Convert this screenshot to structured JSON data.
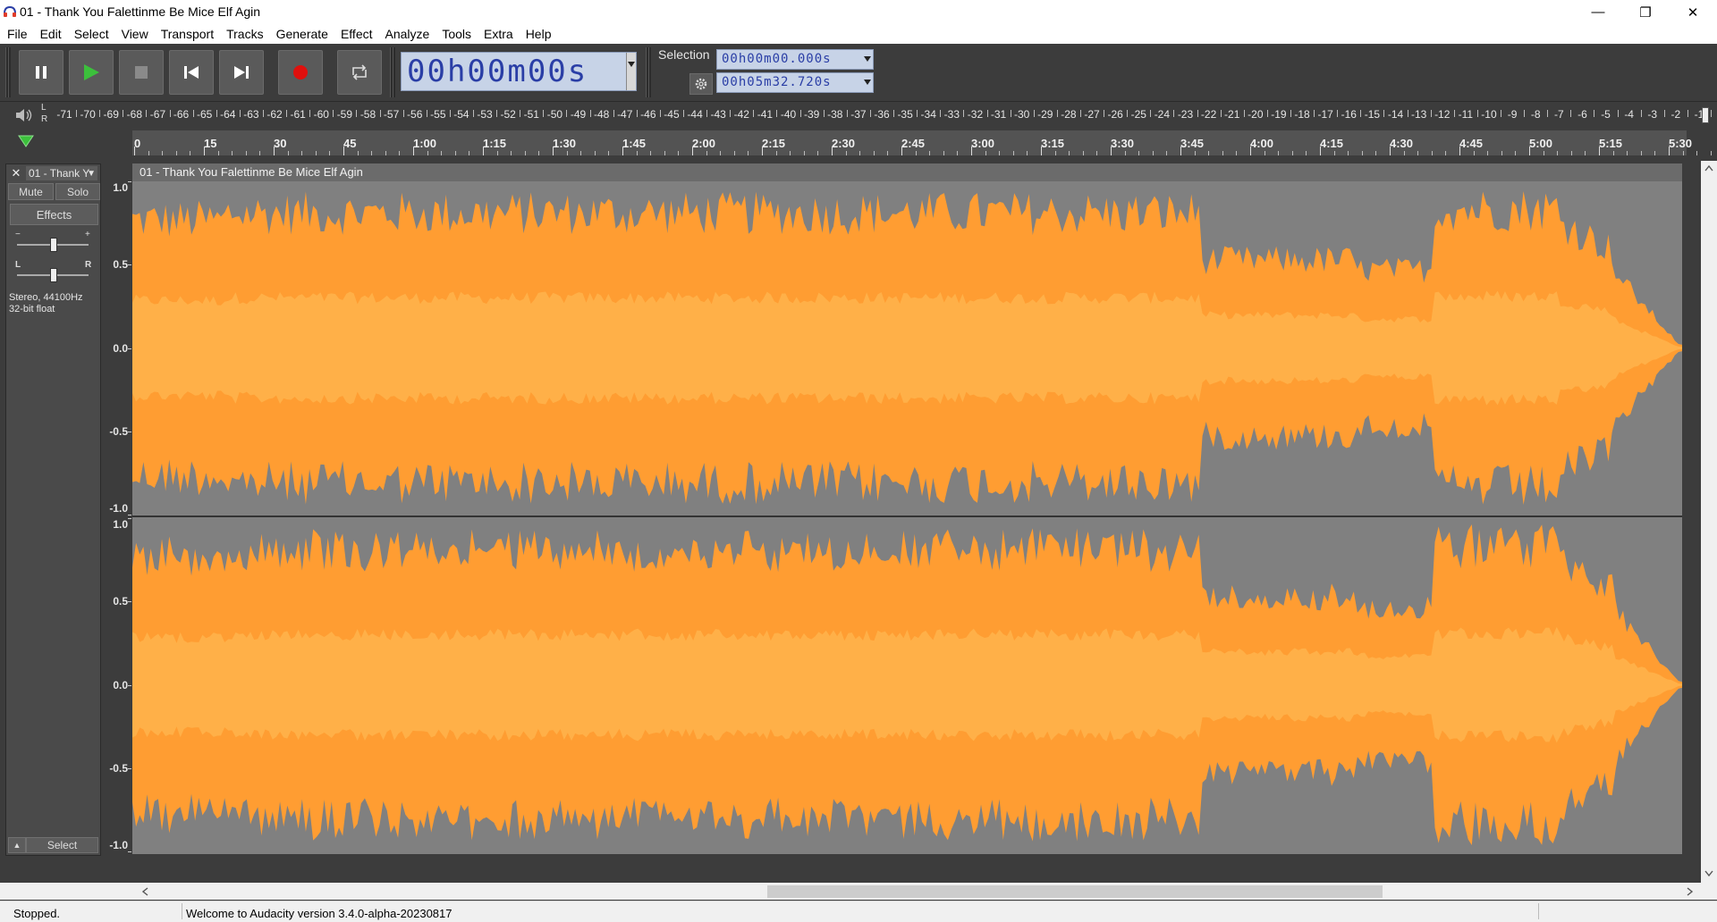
{
  "window": {
    "title": "01 - Thank You Falettinme Be Mice Elf Agin",
    "minimize_glyph": "—",
    "restore_glyph": "❐",
    "close_glyph": "✕"
  },
  "menu": [
    "File",
    "Edit",
    "Select",
    "View",
    "Transport",
    "Tracks",
    "Generate",
    "Effect",
    "Analyze",
    "Tools",
    "Extra",
    "Help"
  ],
  "transport": {
    "buttons": [
      "pause-icon",
      "play-icon",
      "stop-icon",
      "skip-start-icon",
      "skip-end-icon",
      "record-icon",
      "loop-icon"
    ],
    "time": "00h00m00s"
  },
  "selection": {
    "label": "Selection",
    "start": "00h00m00.000s",
    "end": "00h05m32.720s"
  },
  "meter": {
    "l_label": "L",
    "r_label": "R",
    "ticks": [
      "-71",
      "-70",
      "-69",
      "-68",
      "-67",
      "-66",
      "-65",
      "-64",
      "-63",
      "-62",
      "-61",
      "-60",
      "-59",
      "-58",
      "-57",
      "-56",
      "-55",
      "-54",
      "-53",
      "-52",
      "-51",
      "-50",
      "-49",
      "-48",
      "-47",
      "-46",
      "-45",
      "-44",
      "-43",
      "-42",
      "-41",
      "-40",
      "-39",
      "-38",
      "-37",
      "-36",
      "-35",
      "-34",
      "-33",
      "-32",
      "-31",
      "-30",
      "-29",
      "-28",
      "-27",
      "-26",
      "-25",
      "-24",
      "-23",
      "-22",
      "-21",
      "-20",
      "-19",
      "-18",
      "-17",
      "-16",
      "-15",
      "-14",
      "-13",
      "-12",
      "-11",
      "-10",
      "-9",
      "-8",
      "-7",
      "-6",
      "-5",
      "-4",
      "-3",
      "-2",
      "-1"
    ]
  },
  "timeline": {
    "ticks": [
      "0",
      "15",
      "30",
      "45",
      "1:00",
      "1:15",
      "1:30",
      "1:45",
      "2:00",
      "2:15",
      "2:30",
      "2:45",
      "3:00",
      "3:15",
      "3:30",
      "3:45",
      "4:00",
      "4:15",
      "4:30",
      "4:45",
      "5:00",
      "5:15",
      "5:30"
    ]
  },
  "track": {
    "name": "01 - Thank Y",
    "clip_title": "01 - Thank You Falettinme Be Mice Elf Agin",
    "mute": "Mute",
    "solo": "Solo",
    "effects": "Effects",
    "gain_minus": "−",
    "gain_plus": "+",
    "pan_l": "L",
    "pan_r": "R",
    "info_line1": "Stereo, 44100Hz",
    "info_line2": "32-bit float",
    "select": "Select",
    "close_glyph": "✕",
    "collapse_glyph": "▲",
    "menu_glyph": "▼",
    "amplitude_ticks": [
      "1.0",
      "0.5",
      "0.0",
      "-0.5",
      "-1.0"
    ],
    "waveform_color": "#ff9d32",
    "rms_color": "#ffb048"
  },
  "status": {
    "state": "Stopped.",
    "message": "Welcome to Audacity version 3.4.0-alpha-20230817"
  }
}
